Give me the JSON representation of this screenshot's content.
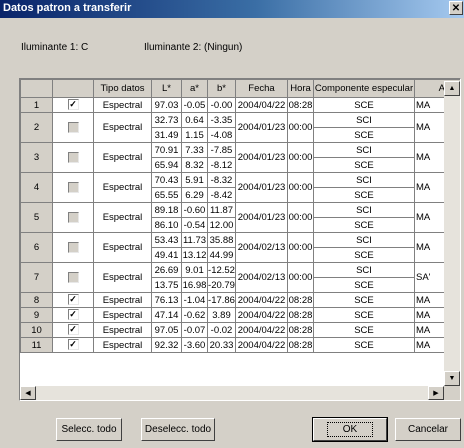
{
  "window": {
    "title": "Datos patron a transferir",
    "close_glyph": "✕"
  },
  "illuminants": {
    "il1": "Iluminante 1:  C",
    "il2": "Iluminante 2:  (Ningun)"
  },
  "table": {
    "columns": [
      "",
      "",
      "Tipo datos",
      "L*",
      "a*",
      "b*",
      "Fecha",
      "Hora",
      "Componente especular",
      "Are"
    ],
    "groups": [
      {
        "num": "1",
        "checked": true,
        "enabled": true,
        "tipo": "Espectral",
        "fecha": "2004/04/22",
        "hora": "08:28",
        "area": "MA",
        "rows": [
          {
            "L": "97.03",
            "a": "-0.05",
            "b": "-0.00",
            "comp": "SCE"
          }
        ]
      },
      {
        "num": "2",
        "checked": false,
        "enabled": false,
        "tipo": "Espectral",
        "fecha": "2004/01/23",
        "hora": "00:00",
        "area": "MA",
        "rows": [
          {
            "L": "32.73",
            "a": "0.64",
            "b": "-3.35",
            "comp": "SCI"
          },
          {
            "L": "31.49",
            "a": "1.15",
            "b": "-4.08",
            "comp": "SCE"
          }
        ]
      },
      {
        "num": "3",
        "checked": false,
        "enabled": false,
        "tipo": "Espectral",
        "fecha": "2004/01/23",
        "hora": "00:00",
        "area": "MA",
        "rows": [
          {
            "L": "70.91",
            "a": "7.33",
            "b": "-7.85",
            "comp": "SCI"
          },
          {
            "L": "65.94",
            "a": "8.32",
            "b": "-8.12",
            "comp": "SCE"
          }
        ]
      },
      {
        "num": "4",
        "checked": false,
        "enabled": false,
        "tipo": "Espectral",
        "fecha": "2004/01/23",
        "hora": "00:00",
        "area": "MA",
        "rows": [
          {
            "L": "70.43",
            "a": "5.91",
            "b": "-8.32",
            "comp": "SCI"
          },
          {
            "L": "65.55",
            "a": "6.29",
            "b": "-8.42",
            "comp": "SCE"
          }
        ]
      },
      {
        "num": "5",
        "checked": false,
        "enabled": false,
        "tipo": "Espectral",
        "fecha": "2004/01/23",
        "hora": "00:00",
        "area": "MA",
        "rows": [
          {
            "L": "89.18",
            "a": "-0.60",
            "b": "11.87",
            "comp": "SCI"
          },
          {
            "L": "86.10",
            "a": "-0.54",
            "b": "12.00",
            "comp": "SCE"
          }
        ]
      },
      {
        "num": "6",
        "checked": false,
        "enabled": false,
        "tipo": "Espectral",
        "fecha": "2004/02/13",
        "hora": "00:00",
        "area": "MA",
        "rows": [
          {
            "L": "53.43",
            "a": "11.73",
            "b": "35.88",
            "comp": "SCI"
          },
          {
            "L": "49.41",
            "a": "13.12",
            "b": "44.99",
            "comp": "SCE"
          }
        ]
      },
      {
        "num": "7",
        "checked": false,
        "enabled": false,
        "tipo": "Espectral",
        "fecha": "2004/02/13",
        "hora": "00:00",
        "area": "SA'",
        "rows": [
          {
            "L": "26.69",
            "a": "9.01",
            "b": "-12.52",
            "comp": "SCI"
          },
          {
            "L": "13.75",
            "a": "16.98",
            "b": "-20.79",
            "comp": "SCE"
          }
        ]
      },
      {
        "num": "8",
        "checked": true,
        "enabled": true,
        "tipo": "Espectral",
        "fecha": "2004/04/22",
        "hora": "08:28",
        "area": "MA",
        "rows": [
          {
            "L": "76.13",
            "a": "-1.04",
            "b": "-17.86",
            "comp": "SCE"
          }
        ]
      },
      {
        "num": "9",
        "checked": true,
        "enabled": true,
        "tipo": "Espectral",
        "fecha": "2004/04/22",
        "hora": "08:28",
        "area": "MA",
        "rows": [
          {
            "L": "47.14",
            "a": "-0.62",
            "b": "3.89",
            "comp": "SCE"
          }
        ]
      },
      {
        "num": "10",
        "checked": true,
        "enabled": true,
        "tipo": "Espectral",
        "fecha": "2004/04/22",
        "hora": "08:28",
        "area": "MA",
        "rows": [
          {
            "L": "97.05",
            "a": "-0.07",
            "b": "-0.02",
            "comp": "SCE"
          }
        ]
      },
      {
        "num": "11",
        "checked": true,
        "enabled": true,
        "tipo": "Espectral",
        "fecha": "2004/04/22",
        "hora": "08:28",
        "area": "MA",
        "rows": [
          {
            "L": "92.32",
            "a": "-3.60",
            "b": "20.33",
            "comp": "SCE"
          }
        ]
      }
    ]
  },
  "scrollbar": {
    "up": "▲",
    "down": "▼",
    "left": "◀",
    "right": "▶"
  },
  "buttons": {
    "select_all": "Selecc. todo",
    "deselect_all": "Deselecc. todo",
    "ok": "OK",
    "cancel": "Cancelar"
  }
}
